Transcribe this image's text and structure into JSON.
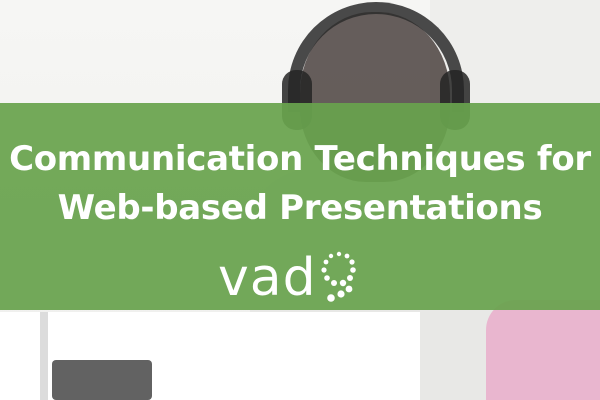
{
  "banner": {
    "title_line_1": "Communication Techniques for",
    "title_line_2": "Web-based Presentations"
  },
  "logo": {
    "text": "vado",
    "brand_prefix": "vad",
    "mark": "dotted-o-logo-mark"
  },
  "colors": {
    "banner_green": "#68a34d",
    "text": "#ffffff",
    "background": "#f3f3f1"
  }
}
